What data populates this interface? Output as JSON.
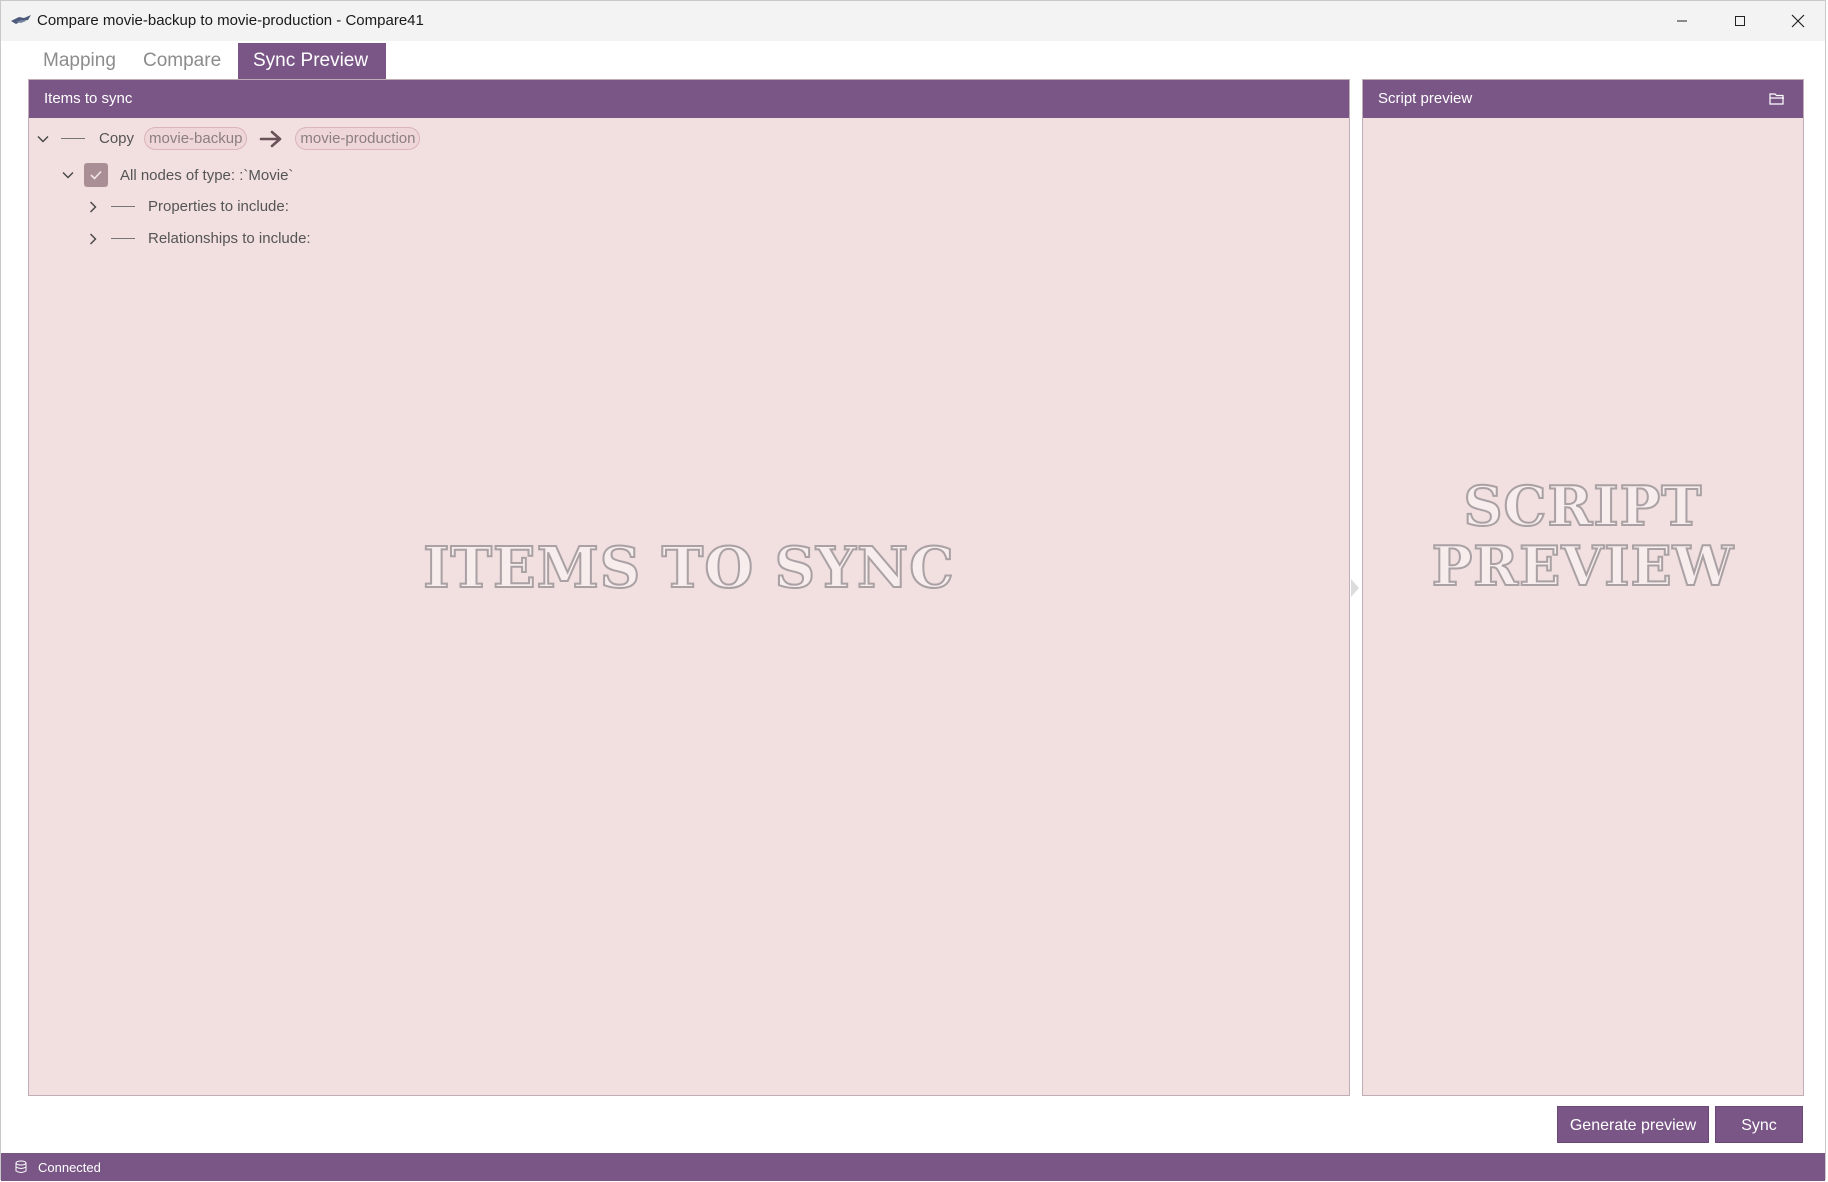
{
  "window": {
    "title": "Compare movie-backup to movie-production - Compare41",
    "app_icon": "compare41-logo-icon",
    "controls": [
      "minimize-icon",
      "maximize-icon",
      "close-icon"
    ]
  },
  "tabs": [
    {
      "label": "Mapping",
      "active": false
    },
    {
      "label": "Compare",
      "active": false
    },
    {
      "label": "Sync Preview",
      "active": true
    }
  ],
  "items_panel": {
    "header": "Items to sync",
    "watermark": "ITEMS TO SYNC",
    "tree": {
      "copy_label": "Copy",
      "source": "movie-backup",
      "target": "movie-production",
      "node_group": {
        "label": "All nodes of type: :`Movie`",
        "checked": true,
        "children": [
          {
            "label": "Properties to include:"
          },
          {
            "label": "Relationships to include:"
          }
        ]
      }
    }
  },
  "script_panel": {
    "header": "Script preview",
    "header_icon": "folder-open-icon",
    "watermark_line1": "SCRIPT",
    "watermark_line2": "PREVIEW"
  },
  "actions": {
    "generate_label": "Generate preview",
    "sync_label": "Sync"
  },
  "status": {
    "icon": "database-icon",
    "text": "Connected"
  },
  "colors": {
    "accent": "#7a5687",
    "panel_bg": "#f2dfe0"
  }
}
